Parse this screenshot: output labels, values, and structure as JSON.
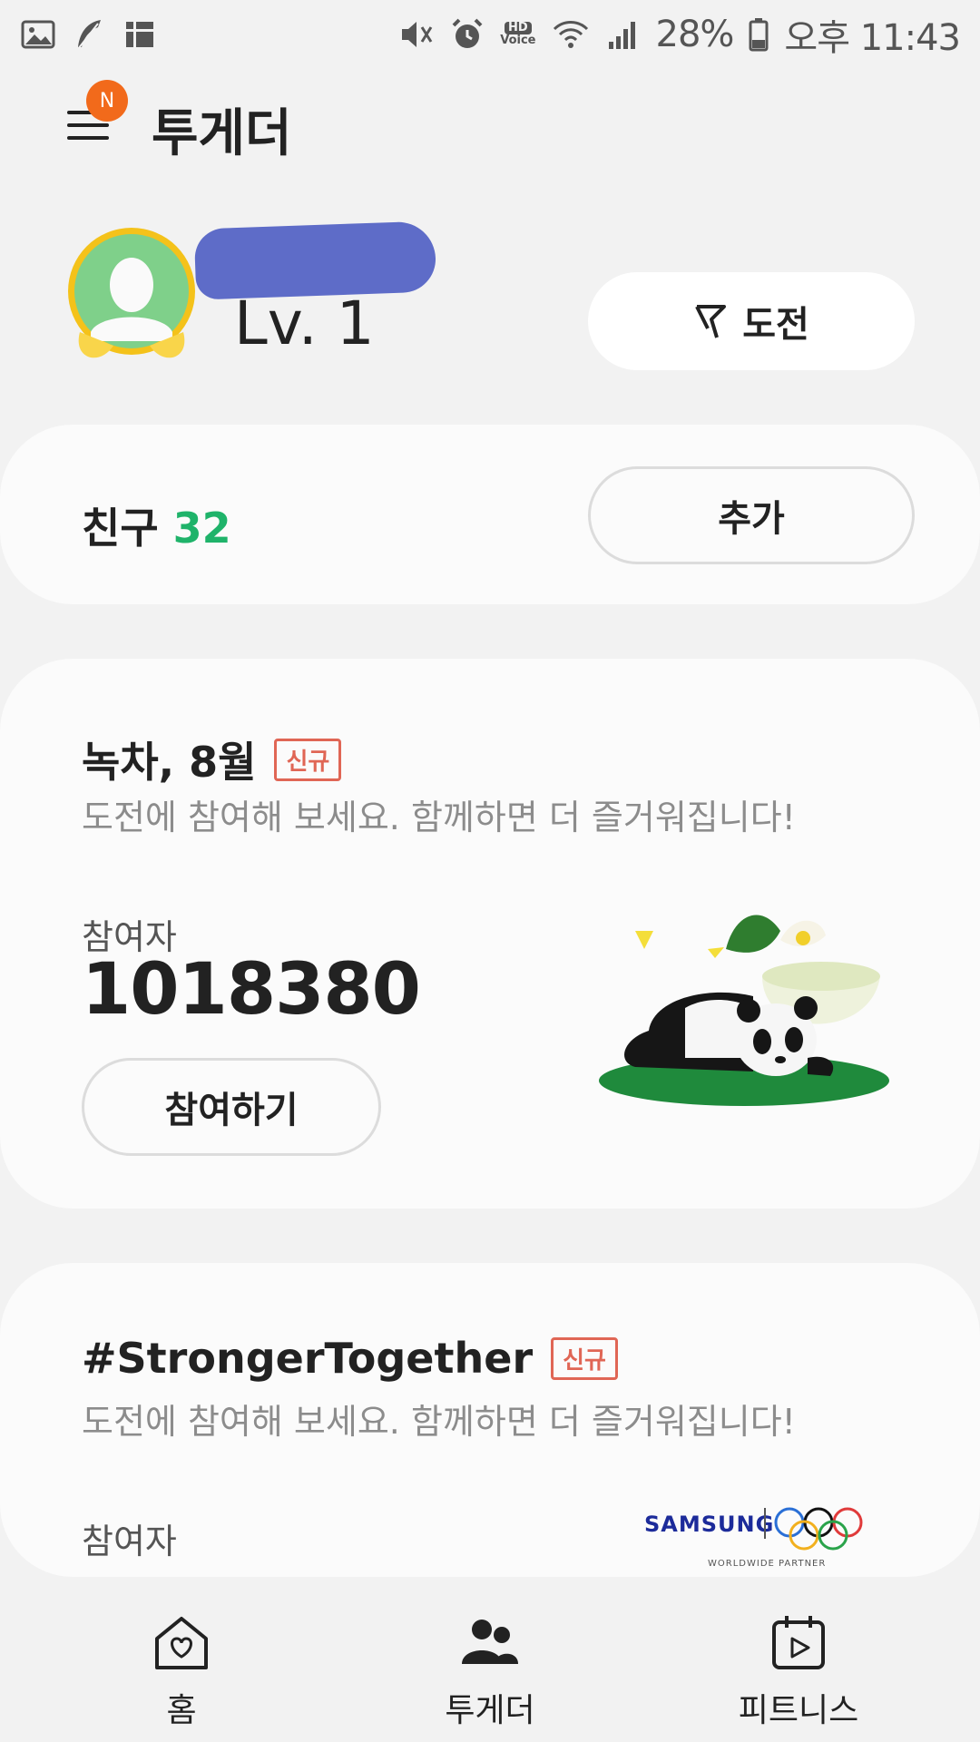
{
  "status_bar": {
    "battery": "28%",
    "time": "오후 11:43",
    "hd_label": "HD",
    "voice_label": "Voice",
    "icons": [
      "gallery-icon",
      "feather-icon",
      "grid-icon",
      "mute-icon",
      "alarm-icon",
      "hd-voice-icon",
      "wifi-icon",
      "signal-icon",
      "battery-icon"
    ]
  },
  "app_bar": {
    "title": "투게더",
    "notification_badge": "N"
  },
  "profile": {
    "level": "Lv. 1",
    "challenge_button": "도전"
  },
  "friends": {
    "label": "친구",
    "count": "32",
    "add_button": "추가"
  },
  "challenges": [
    {
      "title": "녹차, 8월",
      "tag": "신규",
      "description": "도전에 참여해 보세요. 함께하면 더 즐거워집니다!",
      "participants_label": "참여자",
      "participants_value": "1018380",
      "join_button": "참여하기"
    },
    {
      "title": "#StrongerTogether",
      "tag": "신규",
      "description": "도전에 참여해 보세요. 함께하면 더 즐거워집니다!",
      "participants_label": "참여자",
      "sponsor": "SAMSUNG",
      "sponsor_sub": "WORLDWIDE PARTNER"
    }
  ],
  "bottom_nav": {
    "home": "홈",
    "together": "투게더",
    "fitness": "피트니스"
  },
  "colors": {
    "background": "#f2f2f2",
    "card": "#fbfbfb",
    "accent_green": "#1fb36a",
    "new_tag": "#e06655",
    "badge_orange": "#f26a1b"
  }
}
